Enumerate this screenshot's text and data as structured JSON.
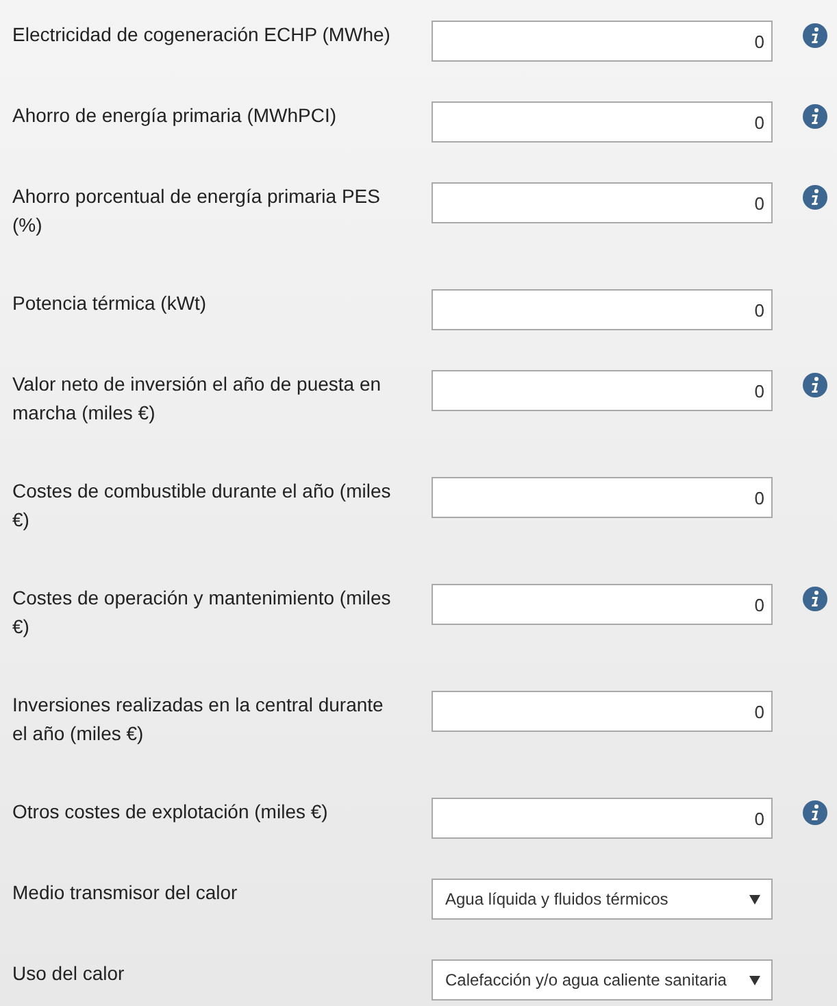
{
  "fields": [
    {
      "kind": "number",
      "label": "Electricidad de cogeneración ECHP (MWhe)",
      "value": "0",
      "info": true
    },
    {
      "kind": "number",
      "label": "Ahorro de energía primaria (MWhPCI)",
      "value": "0",
      "info": true
    },
    {
      "kind": "number",
      "label": "Ahorro porcentual de energía primaria PES (%)",
      "value": "0",
      "info": true
    },
    {
      "kind": "number",
      "label": "Potencia térmica (kWt)",
      "value": "0",
      "info": false
    },
    {
      "kind": "number",
      "label": "Valor neto de inversión el año de puesta en marcha (miles €)",
      "value": "0",
      "info": true
    },
    {
      "kind": "number",
      "label": "Costes de combustible durante el año (miles €)",
      "value": "0",
      "info": false
    },
    {
      "kind": "number",
      "label": "Costes de operación y mantenimiento (miles €)",
      "value": "0",
      "info": true
    },
    {
      "kind": "number",
      "label": "Inversiones realizadas en la central durante el año (miles €)",
      "value": "0",
      "info": false
    },
    {
      "kind": "number",
      "label": "Otros costes de explotación (miles €)",
      "value": "0",
      "info": true
    },
    {
      "kind": "select",
      "label": "Medio transmisor del calor",
      "value": "Agua líquida y fluidos térmicos",
      "info": false
    },
    {
      "kind": "select",
      "label": "Uso del calor",
      "value": "Calefacción y/o agua caliente sanitaria",
      "info": false
    }
  ]
}
